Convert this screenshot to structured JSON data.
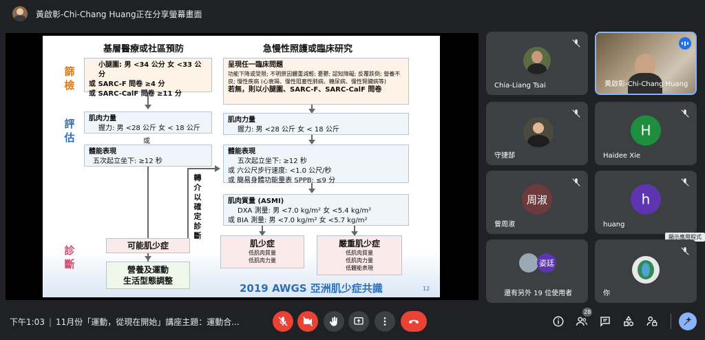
{
  "topbar": {
    "presenting_text": "黃啟彰-Chi-Chang Huang正在分享螢幕畫面"
  },
  "slide": {
    "left_column_title": "基層醫療或社區預防",
    "right_column_title": "急慢性照護或臨床研究",
    "side_labels": {
      "screen": "篩檢",
      "assess": "評估",
      "diagnose": "診斷"
    },
    "left_screen": {
      "line1": "小腿圍: 男 <34 公分 女 <33 公分",
      "line2": "或 SARC-F 問卷 ≥4 分",
      "line3": "或 SARC-CalF 問卷 ≥11 分"
    },
    "right_screen": {
      "title": "呈現任一臨床問題",
      "detail": "功能下降或受限; 不明原因體重減輕; 憂鬱; 認知障礙; 反覆跌倒; 營養不良; 慢性疾病 (心衰竭、慢性阻塞性肺病、糖尿病、慢性腎臟病等)",
      "footer": "若無，則以小腿圍、SARC-F、SARC-CalF 問卷"
    },
    "left_strength": {
      "title": "肌肉力量",
      "value": "握力: 男 <28 公斤 女 < 18 公斤"
    },
    "left_or": "或",
    "left_performance": {
      "title": "體能表現",
      "value": "五次起立坐下: ≥12 秒"
    },
    "right_strength": {
      "title": "肌肉力量",
      "value": "握力: 男 <28 公斤 女 < 18 公斤"
    },
    "right_performance": {
      "title": "體能表現",
      "line1": "五次起立坐下: ≥12 秒",
      "line2": "或 六公尺步行速度: <1.0 公尺/秒",
      "line3": "或 簡易身體功能量表 SPPB: ≤9 分"
    },
    "referral": "轉介以確定診斷",
    "muscle_mass": {
      "title": "肌肉質量 (ASMI)",
      "line1": "DXA 測量: 男 <7.0 kg/m² 女 <5.4 kg/m²",
      "line2": "或  BIA 測量: 男 <7.0 kg/m² 女 <5.7 kg/m²"
    },
    "possible": "可能肌少症",
    "intervention": {
      "line1": "營養及運動",
      "line2": "生活型態調整"
    },
    "sarcopenia": {
      "title": "肌少症",
      "line1": "低肌肉質量",
      "line2": "低肌肉力量"
    },
    "severe": {
      "title": "嚴重肌少症",
      "line1": "低肌肉質量",
      "line2": "低肌肉力量",
      "line3": "低體能表現"
    },
    "footer_title": "2019 AWGS 亞洲肌少症共識",
    "page_number": "12"
  },
  "participants": [
    {
      "name": "Chia-Liang Tsai"
    },
    {
      "name": "黃啟彰-Chi-Chang Huang"
    },
    {
      "name": "守捷郜"
    },
    {
      "name": "Haidee Xie",
      "initial": "H"
    },
    {
      "name": "曾周淑",
      "initial": "周淑"
    },
    {
      "name": "huang",
      "initial": "h"
    },
    {
      "name": "還有另外 19 位使用者",
      "initial": "姿廷"
    },
    {
      "name": "你"
    }
  ],
  "tooltip": "顯示應用程式",
  "bottombar": {
    "time": "下午1:03",
    "meeting_title": "11月份「運動，從現在開始」講座主題：運動合...",
    "people_count": "28"
  },
  "colors": {
    "accent": "#8ab4f8",
    "danger": "#ea4335",
    "orange_label": "#e07b1a",
    "blue_label": "#2c6fb7",
    "pink_label": "#d9476a"
  }
}
